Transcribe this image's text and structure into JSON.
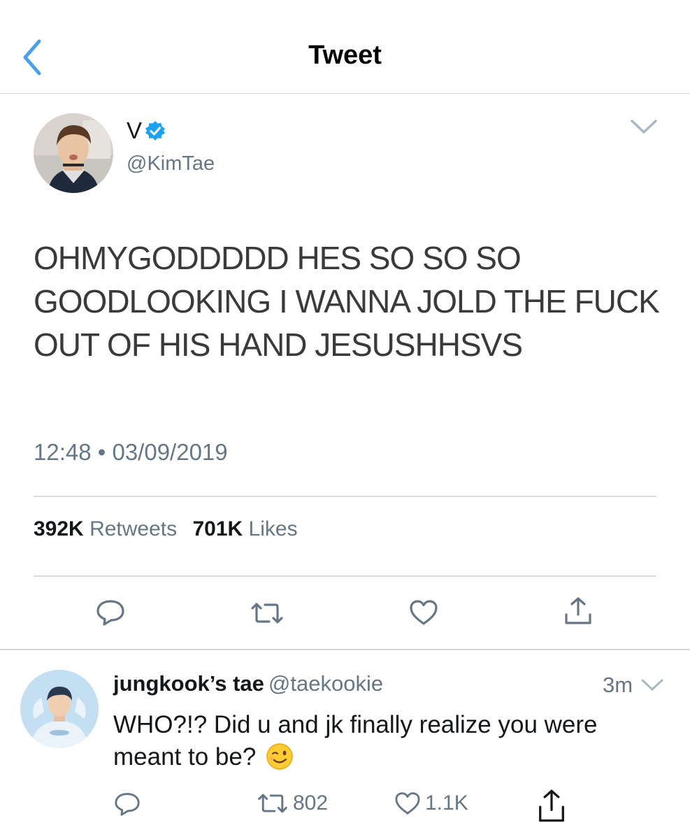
{
  "nav": {
    "title": "Tweet",
    "back_icon": "chevron-left-icon"
  },
  "tweet": {
    "author_name": "V",
    "verified": true,
    "author_handle": "@KimTae",
    "text": "OHMYGODDDDD HES SO SO SO GOODLOOKING I WANNA JOLD THE FUCK OUT OF HIS HAND JESUSHHSVS",
    "timestamp": "12:48 • 03/09/2019",
    "retweets_count": "392K",
    "retweets_label": "Retweets",
    "likes_count": "701K",
    "likes_label": "Likes",
    "actions": [
      "reply-icon",
      "retweet-icon",
      "like-icon",
      "share-icon"
    ]
  },
  "reply": {
    "author_name": "jungkook’s tae",
    "author_handle": "@taekookie",
    "time": "3m",
    "text": "WHO?!? Did u and jk finally realize you were meant to be?",
    "emoji": "winking-face",
    "retweets": "802",
    "likes": "1.1K"
  },
  "colors": {
    "accent": "#4a9fe8",
    "verified": "#1da1f2",
    "secondary_text": "#657786",
    "icon_gray": "#8899a6",
    "divider": "#dcdcdc"
  }
}
